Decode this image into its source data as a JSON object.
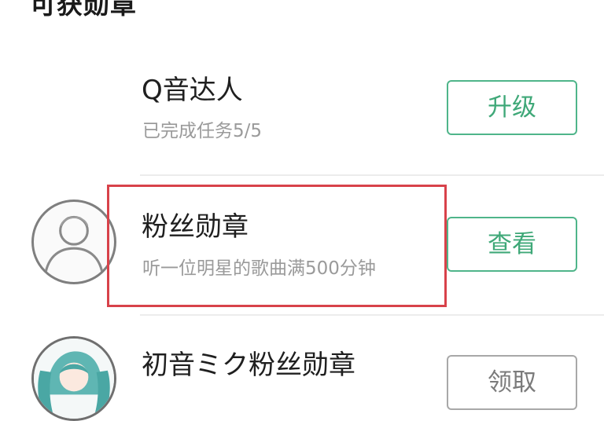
{
  "section": {
    "title": "可获勋章"
  },
  "badges": [
    {
      "title": "Q音达人",
      "desc": "已完成任务5/5",
      "button": "升级",
      "icon": "none"
    },
    {
      "title": "粉丝勋章",
      "desc": "听一位明星的歌曲满500分钟",
      "button": "查看",
      "icon": "person-silhouette-icon"
    },
    {
      "title": "初音ミク粉丝勋章",
      "desc": "",
      "button": "领取",
      "icon": "hatsune-miku-icon"
    }
  ],
  "colors": {
    "accent_green": "#3fa878",
    "button_gray": "#7b7b7b",
    "highlight_red": "#d8424a"
  }
}
